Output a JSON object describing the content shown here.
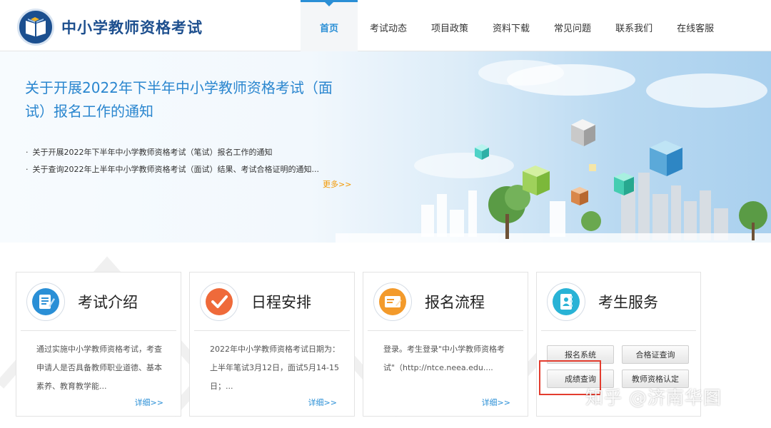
{
  "header": {
    "site_name": "中小学教师资格考试",
    "nav": [
      {
        "label": "首页"
      },
      {
        "label": "考试动态"
      },
      {
        "label": "项目政策"
      },
      {
        "label": "资料下载"
      },
      {
        "label": "常见问题"
      },
      {
        "label": "联系我们"
      },
      {
        "label": "在线客服"
      }
    ],
    "active_color": "#2a8fd6"
  },
  "banner": {
    "title": "关于开展2022年下半年中小学教师资格考试（面试）报名工作的通知",
    "news": [
      "关于开展2022年下半年中小学教师资格考试（笔试）报名工作的通知",
      "关于查询2022年上半年中小学教师资格考试（面试）结果、考试合格证明的通知..."
    ],
    "more": "更多>>"
  },
  "cards": [
    {
      "icon": "document-edit-icon",
      "title": "考试介绍",
      "text": "通过实施中小学教师资格考试，考查申请人是否具备教师职业道德、基本素养、教育教学能...",
      "detail": "详细>>"
    },
    {
      "icon": "checkmark-icon",
      "title": "日程安排",
      "text": "2022年中小学教师资格考试日期为：上半年笔试3月12日，面试5月14-15日；...",
      "detail": "详细>>"
    },
    {
      "icon": "registration-form-icon",
      "title": "报名流程",
      "text": "登录。考生登录\"中小学教师资格考试\"（http://ntce.neea.edu....",
      "detail": "详细>>"
    },
    {
      "icon": "contacts-book-icon",
      "title": "考生服务"
    }
  ],
  "services": {
    "registration": "报名系统",
    "certificate_query": "合格证查询",
    "score_query": "成绩查询",
    "qualification": "教师资格认定"
  },
  "watermark": "知乎 @济南华图",
  "colors": {
    "brand": "#1d4f8e",
    "accent": "#2a8fd6",
    "more": "#f39800",
    "highlight": "#e33c2e"
  }
}
